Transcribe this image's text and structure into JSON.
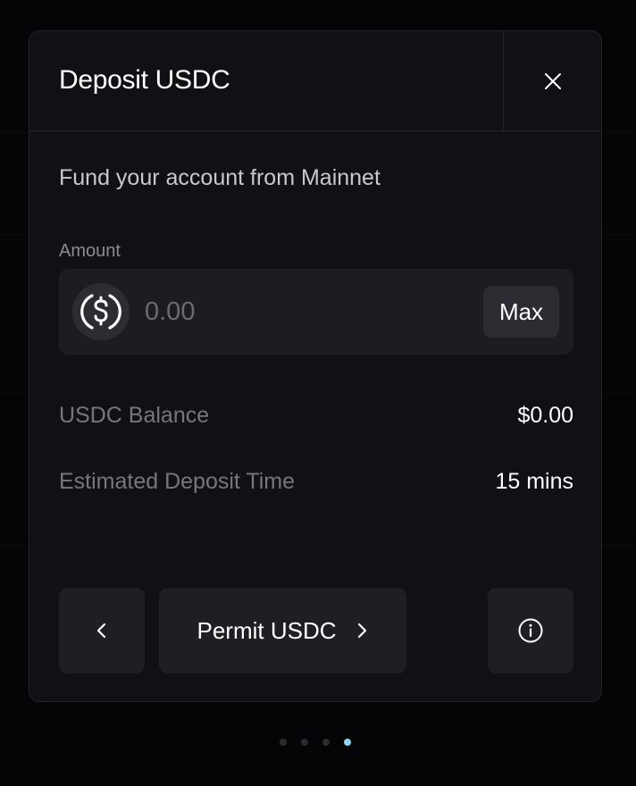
{
  "modal": {
    "title": "Deposit USDC",
    "subtitle": "Fund your account from Mainnet",
    "close_icon": "close-icon"
  },
  "amount": {
    "label": "Amount",
    "placeholder": "0.00",
    "value": "",
    "token_icon": "usdc-coin-icon",
    "max_label": "Max"
  },
  "info": {
    "balance_label": "USDC Balance",
    "balance_value": "$0.00",
    "time_label": "Estimated Deposit Time",
    "time_value": "15 mins"
  },
  "actions": {
    "back_icon": "chevron-left-icon",
    "permit_label": "Permit USDC",
    "permit_icon": "chevron-right-icon",
    "info_icon": "info-icon"
  },
  "pagination": {
    "total": 4,
    "active_index": 3
  },
  "colors": {
    "modal_bg": "#111115",
    "surface": "#1c1c21",
    "muted_text": "#76767e",
    "active_dot": "#8fd3f2"
  }
}
